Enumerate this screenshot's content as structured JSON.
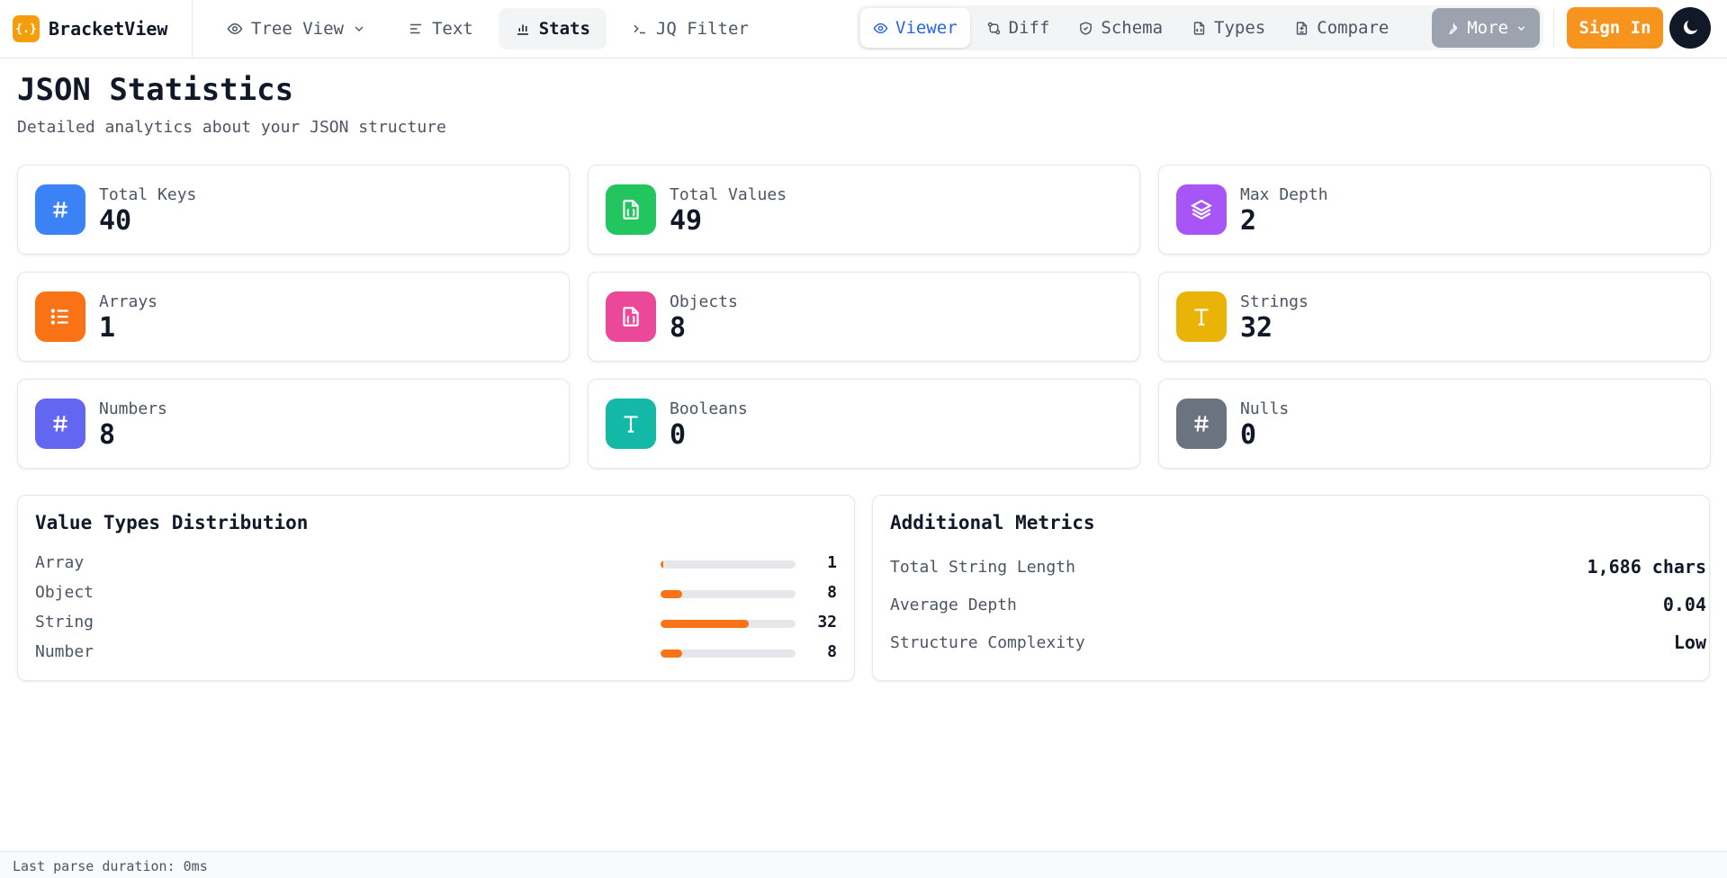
{
  "app": {
    "name": "BracketView",
    "logo_glyph": "{.}"
  },
  "nav": {
    "tree_view": "Tree View",
    "text": "Text",
    "stats": "Stats",
    "jq_filter": "JQ Filter"
  },
  "views": {
    "viewer": "Viewer",
    "diff": "Diff",
    "schema": "Schema",
    "types": "Types",
    "compare": "Compare",
    "more": "More"
  },
  "actions": {
    "sign_in": "Sign In"
  },
  "page": {
    "title": "JSON Statistics",
    "subtitle": "Detailed analytics about your JSON structure"
  },
  "stats": [
    {
      "label": "Total Keys",
      "value": "40",
      "icon": "hash-icon",
      "color": "#3b82f6"
    },
    {
      "label": "Total Values",
      "value": "49",
      "icon": "file-json-icon",
      "color": "#22c55e"
    },
    {
      "label": "Max Depth",
      "value": "2",
      "icon": "layers-icon",
      "color": "#a855f7"
    },
    {
      "label": "Arrays",
      "value": "1",
      "icon": "list-icon",
      "color": "#f97316"
    },
    {
      "label": "Objects",
      "value": "8",
      "icon": "file-json-icon",
      "color": "#ec4899"
    },
    {
      "label": "Strings",
      "value": "32",
      "icon": "type-icon",
      "color": "#eab308"
    },
    {
      "label": "Numbers",
      "value": "8",
      "icon": "hash-icon",
      "color": "#6366f1"
    },
    {
      "label": "Booleans",
      "value": "0",
      "icon": "type-icon",
      "color": "#14b8a6"
    },
    {
      "label": "Nulls",
      "value": "0",
      "icon": "hash-icon",
      "color": "#6b7280"
    }
  ],
  "distribution": {
    "title": "Value Types Distribution",
    "bar_color": "#f97316",
    "rows": [
      {
        "label": "Array",
        "count": 1
      },
      {
        "label": "Object",
        "count": 8
      },
      {
        "label": "String",
        "count": 32
      },
      {
        "label": "Number",
        "count": 8
      }
    ]
  },
  "metrics": {
    "title": "Additional Metrics",
    "rows": [
      {
        "label": "Total String Length",
        "value": "1,686 chars"
      },
      {
        "label": "Average Depth",
        "value": "0.04"
      },
      {
        "label": "Structure Complexity",
        "value": "Low"
      }
    ]
  },
  "footer": {
    "text": "Last parse duration: 0ms"
  }
}
